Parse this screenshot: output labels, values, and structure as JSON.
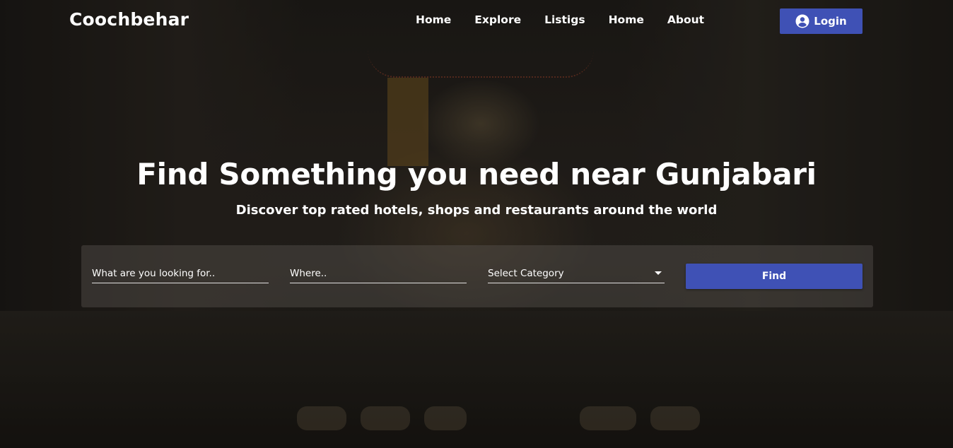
{
  "brand": "Coochbehar",
  "nav": {
    "links": [
      "Home",
      "Explore",
      "Listigs",
      "Home",
      "About"
    ],
    "login_label": "Login"
  },
  "hero": {
    "title": "Find Something you need near Gunjabari",
    "subtitle": "Discover top rated hotels, shops and restaurants around the world"
  },
  "search": {
    "what_placeholder": "What are you looking for..",
    "where_placeholder": "Where..",
    "category_selected": "Select Category",
    "find_label": "Find"
  },
  "colors": {
    "accent": "#3f51b5"
  },
  "icons": {
    "login": "account-circle-icon",
    "dropdown": "caret-down-icon"
  }
}
